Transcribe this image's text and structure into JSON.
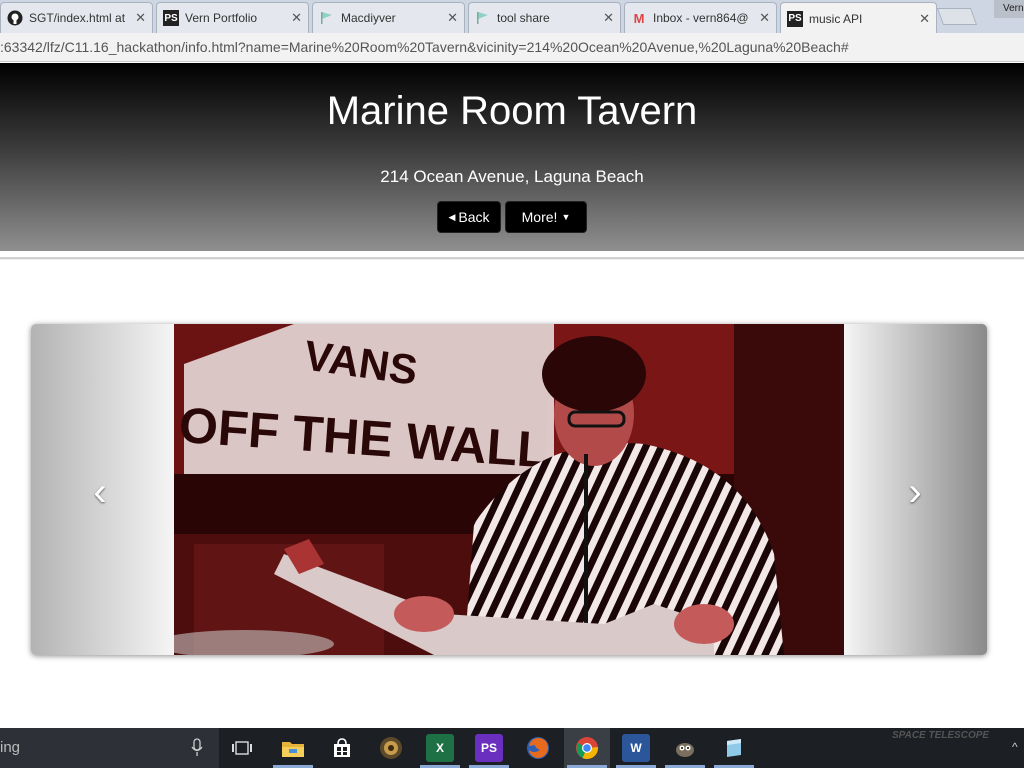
{
  "browser": {
    "tabs": [
      {
        "label": "SGT/index.html at",
        "icon": "github-icon"
      },
      {
        "label": "Vern Portfolio",
        "icon": "phpstorm-icon"
      },
      {
        "label": "Macdiyver",
        "icon": "flag-icon"
      },
      {
        "label": "tool share",
        "icon": "flag-icon"
      },
      {
        "label": "Inbox - vern864@",
        "icon": "gmail-icon"
      },
      {
        "label": "music API",
        "icon": "phpstorm-icon"
      }
    ],
    "user_label": "Vern",
    "url": ":63342/lfz/C11.16_hackathon/info.html?name=Marine%20Room%20Tavern&vicinity=214%20Ocean%20Avenue,%20Laguna%20Beach#"
  },
  "page": {
    "title": "Marine Room Tavern",
    "address": "214 Ocean Avenue, Laguna Beach",
    "back_label": "Back",
    "more_label": "More!"
  },
  "carousel": {
    "prev_icon": "chevron-left-icon",
    "next_icon": "chevron-right-icon",
    "banner_text": [
      "VANS",
      "OFF THE WALL"
    ]
  },
  "taskbar": {
    "search_text": "ing",
    "icons": [
      "task-view-icon",
      "file-explorer-icon",
      "store-icon",
      "speaker-icon",
      "excel-icon",
      "phpstorm-icon",
      "firefox-icon",
      "chrome-icon",
      "word-icon",
      "gimp-icon",
      "notes-icon"
    ],
    "tray_text": "SPACE TELESCOPE"
  }
}
